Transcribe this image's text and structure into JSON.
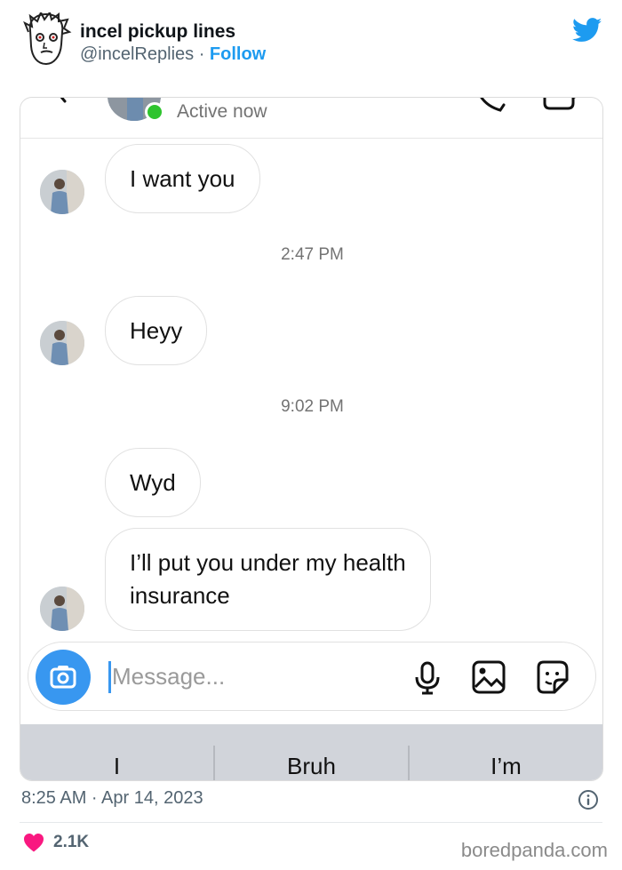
{
  "tweet": {
    "author_name": "incel pickup lines",
    "author_handle": "@incelReplies",
    "separator": " · ",
    "follow_label": "Follow",
    "timestamp": "8:25 AM · Apr 14, 2023",
    "like_count": "2.1K",
    "icons": [
      "twitter-bird-icon",
      "info-icon",
      "heart-icon"
    ]
  },
  "chat": {
    "status": "Active now",
    "messages": [
      {
        "text": "I want you"
      },
      {
        "text": "Heyy"
      },
      {
        "text": "Wyd"
      },
      {
        "text": "I’ll put you under my health insurance",
        "line1": "I’ll put you under my health",
        "line2": "insurance"
      }
    ],
    "timestamps": [
      "2:47 PM",
      "9:02 PM"
    ],
    "composer": {
      "placeholder": "Message..."
    },
    "suggestions": [
      "I",
      "Bruh",
      "I’m"
    ],
    "colors": {
      "accent": "#3897f0",
      "online": "#2ec42e",
      "follow": "#1d9bf0",
      "like": "#f91880"
    }
  },
  "watermark": "boredpanda.com"
}
